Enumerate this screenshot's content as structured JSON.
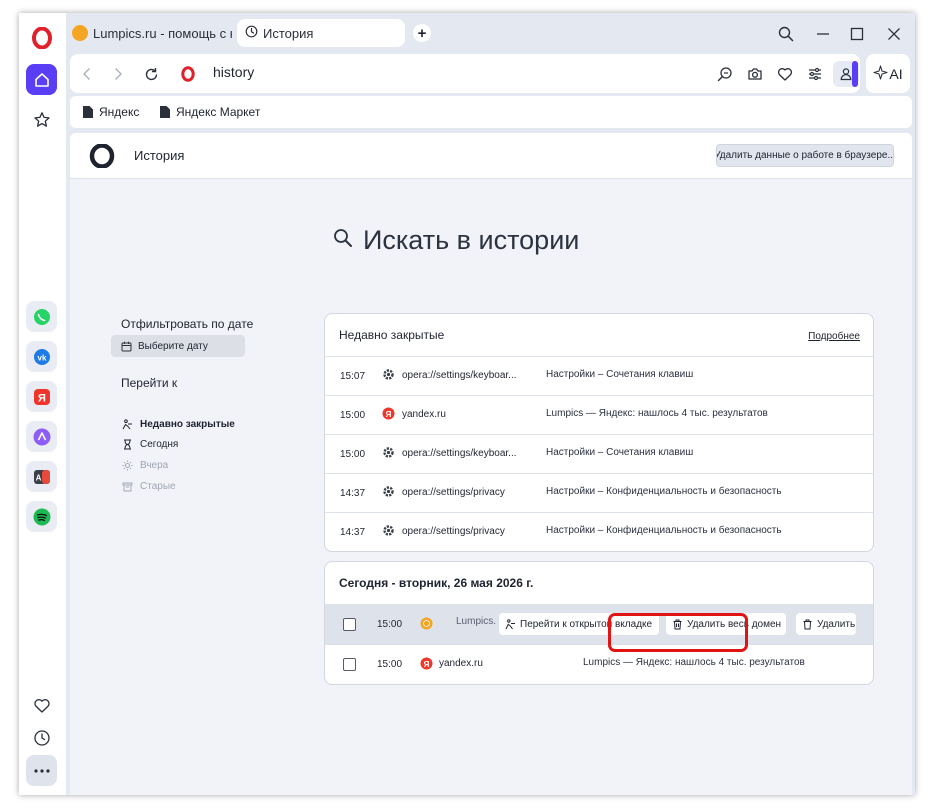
{
  "tabs": [
    {
      "label": "Lumpics.ru - помощь с ко"
    },
    {
      "label": "История"
    }
  ],
  "address": {
    "url": "history",
    "ai_label": "AI"
  },
  "bookmarks": [
    {
      "label": "Яндекс"
    },
    {
      "label": "Яндекс Маркет"
    }
  ],
  "header": {
    "title": "История",
    "clear_button": "Удалить данные о работе в браузере..."
  },
  "search": {
    "placeholder": "Искать в истории"
  },
  "filter": {
    "title": "Отфильтровать по дате",
    "date_button": "Выберите дату",
    "goto_title": "Перейти к",
    "goto_items": [
      {
        "label": "Недавно закрытые"
      },
      {
        "label": "Сегодня"
      },
      {
        "label": "Вчера"
      },
      {
        "label": "Старые"
      }
    ]
  },
  "recent": {
    "title": "Недавно закрытые",
    "more": "Подробнее",
    "rows": [
      {
        "time": "15:07",
        "icon": "gear-icon",
        "url": "opera://settings/keyboar...",
        "title": "Настройки – Сочетания клавиш"
      },
      {
        "time": "15:00",
        "icon": "yandex-icon",
        "url": "yandex.ru",
        "title": "Lumpics — Яндекс: нашлось 4 тыс. результатов"
      },
      {
        "time": "15:00",
        "icon": "gear-icon",
        "url": "opera://settings/keyboar...",
        "title": "Настройки – Сочетания клавиш"
      },
      {
        "time": "14:37",
        "icon": "gear-icon",
        "url": "opera://settings/privacy",
        "title": "Настройки – Конфиденциальность и безопасность"
      },
      {
        "time": "14:37",
        "icon": "gear-icon",
        "url": "opera://settings/privacy",
        "title": "Настройки – Конфиденциальность и безопасность"
      }
    ]
  },
  "today": {
    "title": "Сегодня - вторник, 26 мая 2026 г.",
    "rows": [
      {
        "time": "15:00",
        "domain": "Lumpics.",
        "go_tab": "Перейти к открытой вкладке",
        "delete_domain": "Удалить весь домен",
        "delete": "Удалить"
      },
      {
        "time": "15:00",
        "url": "yandex.ru",
        "title": "Lumpics — Яндекс: нашлось 4 тыс. результатов"
      }
    ]
  },
  "colors": {
    "accent": "#5a3ef6",
    "opera_red": "#e0202b",
    "highlight": "#e11414"
  }
}
